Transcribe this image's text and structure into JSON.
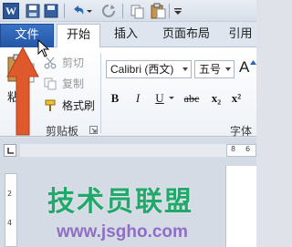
{
  "qat": {
    "logo_letter": "W",
    "icons": [
      "word-logo-icon",
      "save-icon",
      "disk-icon",
      "undo-icon",
      "undo-dropdown-icon",
      "redo-icon",
      "copy-icon",
      "paste-icon",
      "customize-qat-icon"
    ]
  },
  "tabs": {
    "file": "文件",
    "home": "开始",
    "insert": "插入",
    "page_layout": "页面布局",
    "references": "引用"
  },
  "clipboard": {
    "paste": "粘",
    "cut": "剪切",
    "copy": "复制",
    "format_painter": "格式刷",
    "group_label": "剪贴板"
  },
  "font": {
    "font_name": "Calibri (西文)",
    "font_size": "五号",
    "grow": "A",
    "bold": "B",
    "italic": "I",
    "underline": "U",
    "strikethrough": "abc",
    "subscript": "x₂",
    "superscript": "x²",
    "group_label": "字体"
  },
  "ruler": {
    "tick_8": "8",
    "tick_6": "6",
    "tick_2": "2",
    "tick_4": "4"
  },
  "watermark": {
    "title": "技术员联盟",
    "url": "www.jsgho.com"
  },
  "colors": {
    "file_tab": "#2b5ea8",
    "arrow": "#e0592c",
    "watermark_green": "#21a86b",
    "watermark_purple": "#8f6fc6"
  }
}
